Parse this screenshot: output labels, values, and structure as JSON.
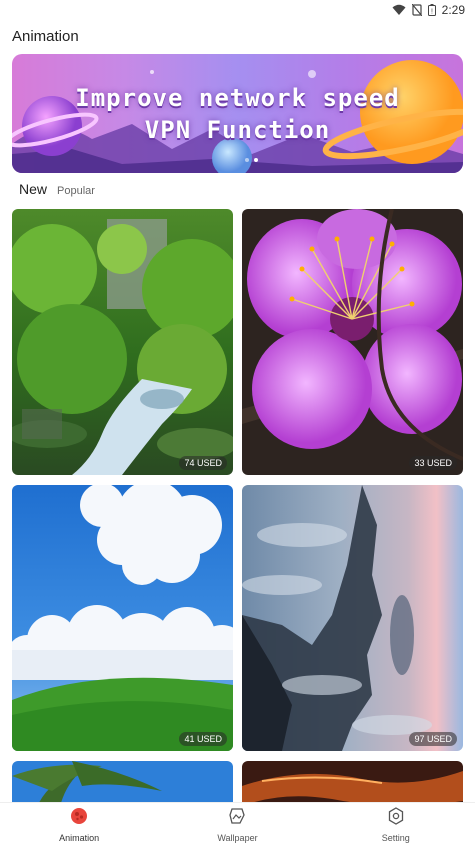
{
  "status_bar": {
    "time": "2:29",
    "icons": [
      "wifi-icon",
      "signal-off-icon",
      "battery-icon"
    ]
  },
  "header": {
    "title": "Animation"
  },
  "banner": {
    "line1": "Improve network speed",
    "line2": "VPN Function",
    "page_count": 2,
    "active_page": 2
  },
  "tabs": {
    "new_label": "New",
    "popular_label": "Popular"
  },
  "wallpapers": [
    {
      "name": "forest-stream",
      "used": "74 USED"
    },
    {
      "name": "pink-blossom",
      "used": "33 USED"
    },
    {
      "name": "blue-sky-hill",
      "used": "41 USED"
    },
    {
      "name": "sea-of-clouds",
      "used": "97 USED"
    },
    {
      "name": "palm-sky"
    },
    {
      "name": "sunset-clouds"
    }
  ],
  "bottom_nav": {
    "animation_label": "Animation",
    "wallpaper_label": "Wallpaper",
    "setting_label": "Setting"
  },
  "colors": {
    "accent": "#e8453c",
    "banner_purple": "#b083e6"
  }
}
